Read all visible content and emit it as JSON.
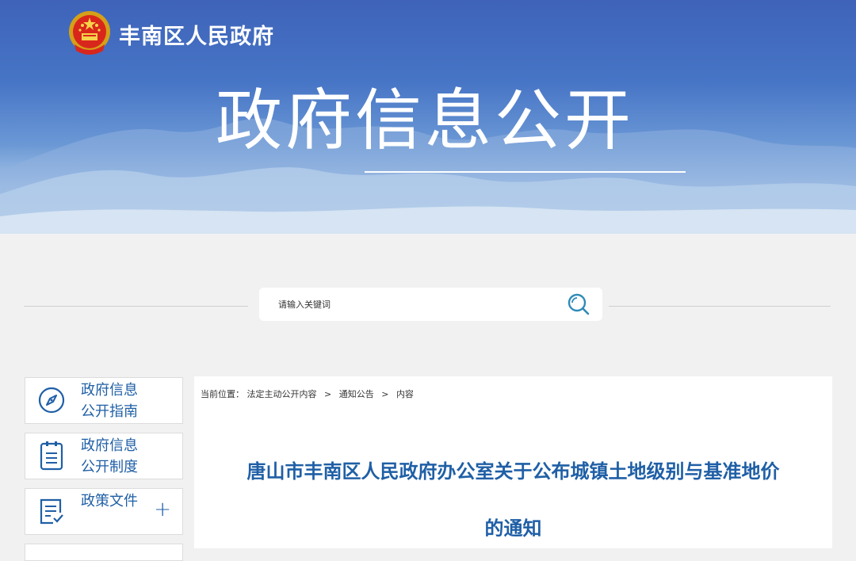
{
  "header": {
    "site_name": "丰南区人民政府",
    "hero_title": "政府信息公开"
  },
  "search": {
    "placeholder": "请输入关键词",
    "icon": "search-icon"
  },
  "sidebar": {
    "items": [
      {
        "label_line1": "政府信息",
        "label_line2": "公开指南",
        "icon": "compass-icon"
      },
      {
        "label_line1": "政府信息",
        "label_line2": "公开制度",
        "icon": "clipboard-icon"
      },
      {
        "label": "政策文件",
        "icon": "document-check-icon",
        "expand": "+"
      }
    ]
  },
  "breadcrumb": {
    "prefix": "当前位置：",
    "items": [
      "法定主动公开内容",
      "通知公告",
      "内容"
    ],
    "separator": ">"
  },
  "article": {
    "title_line1": "唐山市丰南区人民政府办公室关于公布城镇土地级别与基准地价",
    "title_line2": "的通知"
  },
  "colors": {
    "banner": "#4775c6",
    "accent_blue": "#1f5fa6",
    "search_icon": "#2e8bb8",
    "page_bg": "#f1f1f1"
  }
}
